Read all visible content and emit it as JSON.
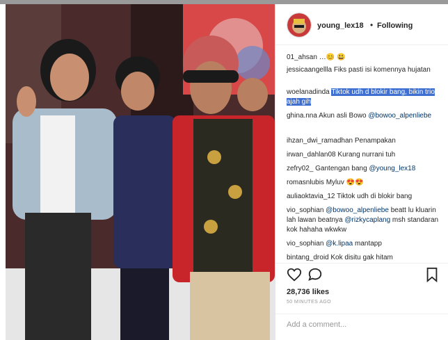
{
  "post": {
    "username": "young_lex18",
    "follow_label": "Following",
    "separator": "•",
    "likes": "28,736 likes",
    "time": "50 MINUTES AGO",
    "add_comment_placeholder": "Add a comment..."
  },
  "comments": [
    {
      "user": "01_ahsan",
      "text": "…😊 😃"
    },
    {
      "user": "jessicaangellla",
      "text": "Fiks pasti isi komennya hujatan"
    },
    {
      "user": "woelanadinda",
      "text": "Tiktok udh d blokir bang, bikin trio ajah gih",
      "highlighted": true
    },
    {
      "user": "ghina.nna",
      "text": "Akun asli Bowo",
      "mention": "@bowoo_alpenliebe"
    },
    {
      "user": "ihzan_dwi_ramadhan",
      "text": "Penampakan"
    },
    {
      "user": "irwan_dahlan08",
      "text": "Kurang nurrani tuh"
    },
    {
      "user": "zefry02_",
      "text": "Gantengan bang",
      "mention": "@young_lex18"
    },
    {
      "user": "romasnlubis",
      "text": "Myluv 😍😍"
    },
    {
      "user": "auliaoktavia_12",
      "text": "Tiktok udh di blokir bang"
    },
    {
      "user": "vio_sophian",
      "mention": "@bowoo_alpenliebe",
      "text": "beatt lu kluarin lah lawan beatnya",
      "mention2": "@rizkycaplang",
      "text2": "msh standaran kok hahaha wkwkw"
    },
    {
      "user": "vio_sophian",
      "mention": "@k.lipaa",
      "text": "mantapp"
    },
    {
      "user": "bintang_droid",
      "text": "Kok disitu gak hitam"
    }
  ],
  "icons": [
    "heart-icon",
    "comment-icon",
    "bookmark-icon"
  ],
  "colors": {
    "highlight": "#3e6fd1",
    "mention": "#003569",
    "jacket": "#c8252b"
  }
}
